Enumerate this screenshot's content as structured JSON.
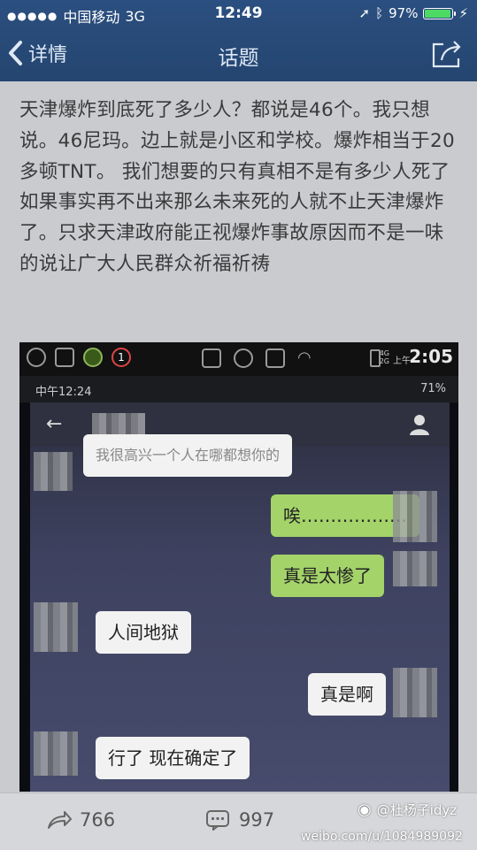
{
  "status_bar": {
    "carrier": "中国移动",
    "network": "3G",
    "time": "12:49",
    "battery": "97%"
  },
  "nav": {
    "back_label": "详情",
    "title": "话题"
  },
  "post": {
    "text": "天津爆炸到底死了多少人？都说是46个。我只想说。46尼玛。边上就是小区和学校。爆炸相当于20多顿TNT。 我们想要的只有真相不是有多少人死了如果事实再不出来那么未来死的人就不止天津爆炸了。只求天津政府能正视爆炸事故原因而不是一味的说让广大人民群众祈福祈祷"
  },
  "embedded_screenshot": {
    "top_clock": "2:05",
    "top_network": "上午",
    "net_label_1": "4G",
    "net_label_2": "2G",
    "sub_time": "中午12:24",
    "sub_battery": "71%",
    "messages": [
      {
        "side": "left",
        "text": "我很高兴一个人在哪都想你的"
      },
      {
        "side": "right",
        "text": "唉………………"
      },
      {
        "side": "right",
        "text": "真是太惨了"
      },
      {
        "side": "left",
        "text": "人间地狱"
      },
      {
        "side": "right",
        "text": "真是啊"
      },
      {
        "side": "left",
        "text": "行了 现在确定了"
      }
    ]
  },
  "bottom_bar": {
    "repost_count": "766",
    "comment_count": "997",
    "watermark_user": "@杜杨子idyz",
    "watermark_url": "weibo.com/u/1084989092"
  },
  "colors": {
    "nav_bg": "#24456f",
    "bubble_green": "#a4d36a",
    "bubble_white": "#f2f2f2"
  }
}
